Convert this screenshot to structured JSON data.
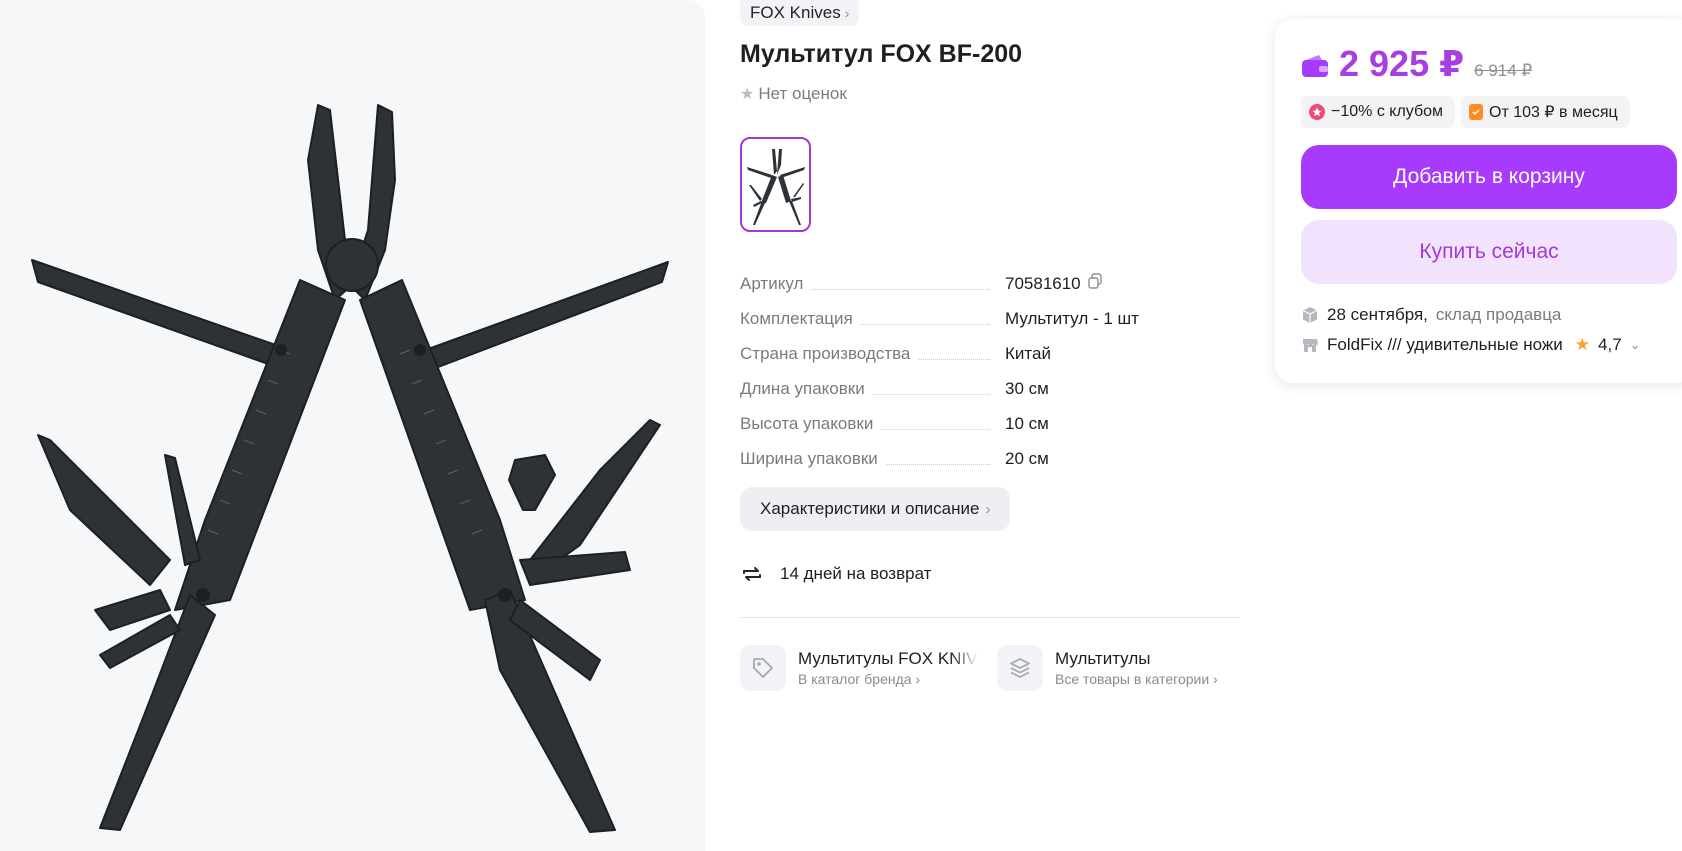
{
  "product": {
    "brand_chip": "FOX Knives",
    "title": "Мультитул FOX BF-200",
    "rating_text": "Нет оценок"
  },
  "specs": [
    {
      "label": "Артикул",
      "value": "70581610"
    },
    {
      "label": "Комплектация",
      "value": "Мультитул - 1 шт"
    },
    {
      "label": "Страна производства",
      "value": "Китай"
    },
    {
      "label": "Длина упаковки",
      "value": "30 см"
    },
    {
      "label": "Высота упаковки",
      "value": "10 см"
    },
    {
      "label": "Ширина упаковки",
      "value": "20 см"
    }
  ],
  "characteristics_button": "Характеристики и описание",
  "return_policy": "14 дней на возврат",
  "links": {
    "brand": {
      "title": "Мультитулы FOX KNIVES",
      "subtitle": "В каталог бренда"
    },
    "category": {
      "title": "Мультитулы",
      "subtitle": "Все товары в категории"
    }
  },
  "purchase": {
    "price": "2 925 ₽",
    "old_price": "6 914 ₽",
    "club_badge": "−10% с клубом",
    "installment_badge": "От 103 ₽ в месяц",
    "add_to_cart": "Добавить в корзину",
    "buy_now": "Купить сейчас",
    "delivery_date": "28 сентября,",
    "delivery_source": "склад продавца",
    "seller_name": "FoldFix /// удивительные ножи",
    "seller_rating": "4,7"
  },
  "colors": {
    "accent": "#a73afd",
    "accent_text": "#a83ee0",
    "accent_light": "#f1e3fd",
    "star_orange": "#ff9b2f"
  },
  "icons": [
    "chevron-right-icon",
    "star-icon",
    "copy-icon",
    "return-arrows-icon",
    "tag-icon",
    "layers-icon",
    "wallet-icon",
    "club-badge-icon",
    "installment-badge-icon",
    "box-icon",
    "shop-icon",
    "chevron-down-icon"
  ]
}
